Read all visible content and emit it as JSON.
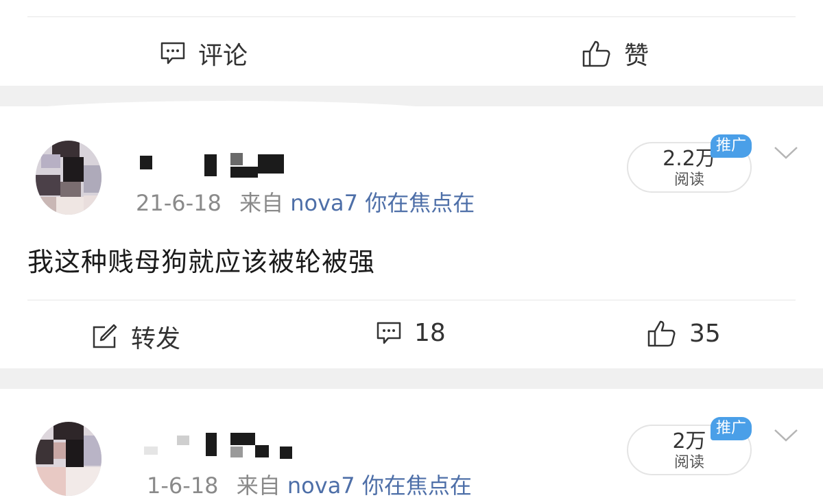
{
  "top_actions": {
    "comment_label": "评论",
    "like_label": "赞"
  },
  "posts": [
    {
      "meta_date": "21-6-18",
      "meta_from": "来自",
      "source": "nova7 你在焦点在",
      "content": "我这种贱母狗就应该被轮被强",
      "reads_count": "2.2万",
      "reads_label": "阅读",
      "promo_badge": "推广",
      "actions": {
        "repost_label": "转发",
        "comment_count": "18",
        "like_count": "35"
      }
    },
    {
      "meta_date": "1-6-18",
      "meta_from": "来自",
      "source": "nova7 你在焦点在",
      "reads_count": "2万",
      "reads_label": "阅读",
      "promo_badge": "推广"
    }
  ],
  "icons": [
    "comment-icon",
    "like-icon",
    "repost-icon",
    "chevron-down-icon"
  ],
  "colors": {
    "source_link": "#4e6fa8",
    "promo_badge": "#4a9fe8",
    "separator": "#f0f0f0"
  }
}
